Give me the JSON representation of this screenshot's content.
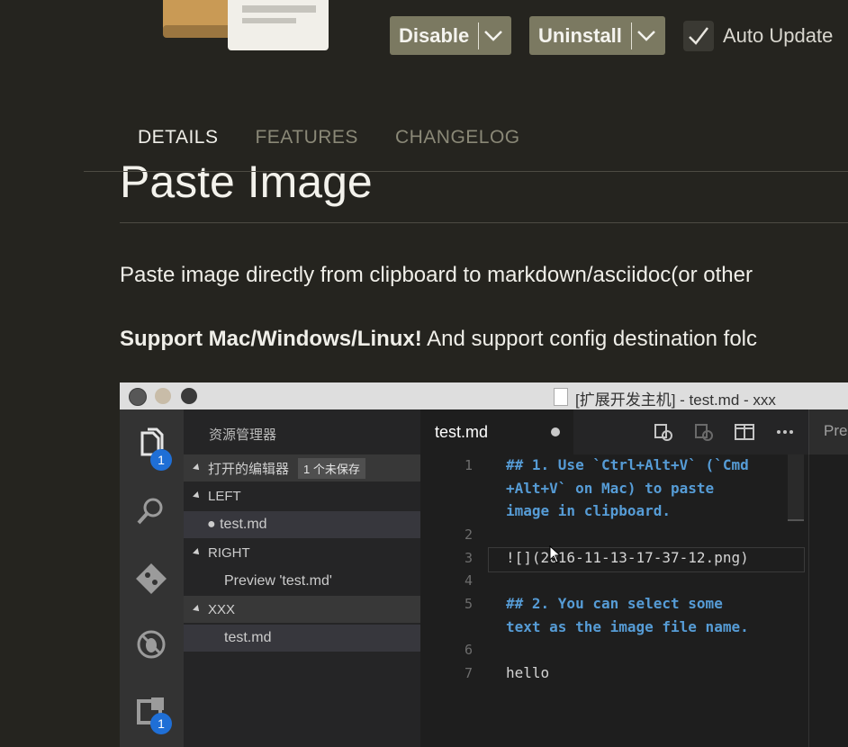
{
  "header": {
    "disable_label": "Disable",
    "uninstall_label": "Uninstall",
    "auto_update_label": "Auto Update"
  },
  "tabs": [
    {
      "label": "DETAILS",
      "active": true
    },
    {
      "label": "FEATURES",
      "active": false
    },
    {
      "label": "CHANGELOG",
      "active": false
    }
  ],
  "readme": {
    "title": "Paste Image",
    "para1": "Paste image directly from clipboard to markdown/asciidoc(or other",
    "para2_bold": "Support Mac/Windows/Linux!",
    "para2_rest": " And support config destination folc"
  },
  "screenshot": {
    "window_title": "[扩展开发主机] - test.md - xxx",
    "sidebar": {
      "title": "资源管理器",
      "open_editors": "打开的编辑器",
      "unsaved_pill": "1 个未保存",
      "group_left": "LEFT",
      "left_file": "● test.md",
      "group_right": "RIGHT",
      "right_file": "Preview 'test.md'",
      "folder": "XXX",
      "folder_file": "test.md"
    },
    "badges": {
      "explorer": "1",
      "extensions": "1"
    },
    "editor_tab": "test.md",
    "preview_tab": "Pre",
    "line_numbers": [
      "1",
      "2",
      "3",
      "4",
      "5",
      "6",
      "7"
    ],
    "code": {
      "l1a": "## 1. Use `Ctrl+Alt+V` (`Cmd",
      "l1b": "+Alt+V` on Mac) to paste",
      "l1c": "image in clipboard.",
      "l3": "![](2016-11-13-17-37-12.png)",
      "l5a": "## 2. You can select some",
      "l5b": "text as the image file name.",
      "l7": "hello"
    }
  },
  "colors": {
    "background": "#25241f",
    "button": "#7b7961",
    "badge": "#1f6fd6",
    "markdown_heading": "#569cd6"
  },
  "icons": [
    "extension-logo-icon",
    "chevron-down-icon",
    "checkmark-icon",
    "files-icon",
    "search-icon",
    "git-icon",
    "debug-icon",
    "extensions-icon",
    "open-changes-icon",
    "split-editor-icon",
    "more-icon"
  ]
}
